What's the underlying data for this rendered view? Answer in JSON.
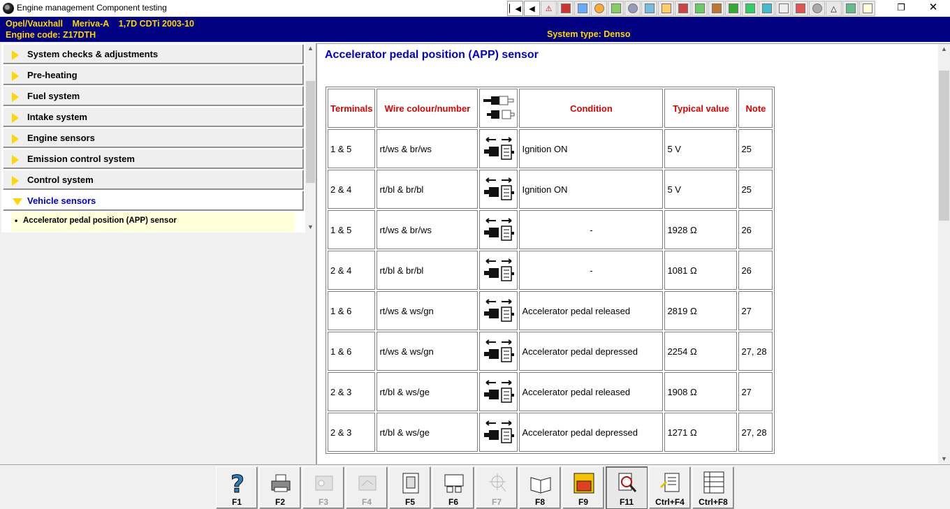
{
  "window": {
    "title": "Engine management Component testing"
  },
  "vehicle": {
    "make": "Opel/Vauxhall",
    "model": "Meriva-A",
    "engine": "1,7D CDTi 2003-10",
    "engine_code": "Engine code: Z17DTH",
    "system_type": "System type: Denso"
  },
  "nav": {
    "items": [
      {
        "label": "System checks & adjustments"
      },
      {
        "label": "Pre-heating"
      },
      {
        "label": "Fuel system"
      },
      {
        "label": "Intake system"
      },
      {
        "label": "Engine sensors"
      },
      {
        "label": "Emission control system"
      },
      {
        "label": "Control system"
      },
      {
        "label": "Vehicle sensors"
      }
    ],
    "subitem": "Accelerator pedal position (APP) sensor"
  },
  "content": {
    "title": "Accelerator pedal position (APP) sensor",
    "headers": {
      "terminals": "Terminals",
      "wire": "Wire colour/number",
      "condition": "Condition",
      "value": "Typical value",
      "note": "Note"
    },
    "rows": [
      {
        "terminals": "1 & 5",
        "wire": "rt/ws & br/ws",
        "condition": "Ignition ON",
        "value": "5 V",
        "note": "25"
      },
      {
        "terminals": "2 & 4",
        "wire": "rt/bl & br/bl",
        "condition": "Ignition ON",
        "value": "5 V",
        "note": "25"
      },
      {
        "terminals": "1 & 5",
        "wire": "rt/ws & br/ws",
        "condition": "-",
        "value": "1928 Ω",
        "note": "26"
      },
      {
        "terminals": "2 & 4",
        "wire": "rt/bl & br/bl",
        "condition": "-",
        "value": "1081 Ω",
        "note": "26"
      },
      {
        "terminals": "1 & 6",
        "wire": "rt/ws & ws/gn",
        "condition": "Accelerator pedal released",
        "value": "2819 Ω",
        "note": "27"
      },
      {
        "terminals": "1 & 6",
        "wire": "rt/ws & ws/gn",
        "condition": "Accelerator pedal depressed",
        "value": "2254 Ω",
        "note": "27, 28"
      },
      {
        "terminals": "2 & 3",
        "wire": "rt/bl & ws/ge",
        "condition": "Accelerator pedal released",
        "value": "1908 Ω",
        "note": "27"
      },
      {
        "terminals": "2 & 3",
        "wire": "rt/bl & ws/ge",
        "condition": "Accelerator pedal depressed",
        "value": "1271 Ω",
        "note": "27, 28"
      }
    ]
  },
  "function_keys": [
    {
      "label": "F1",
      "icon": "help-icon"
    },
    {
      "label": "F2",
      "icon": "printer-icon"
    },
    {
      "label": "F3",
      "icon": "component-location-icon",
      "disabled": true
    },
    {
      "label": "F4",
      "icon": "wiring-icon",
      "disabled": true
    },
    {
      "label": "F5",
      "icon": "fuse-icon"
    },
    {
      "label": "F6",
      "icon": "ecu-icon"
    },
    {
      "label": "F7",
      "icon": "adjustment-icon",
      "disabled": true
    },
    {
      "label": "F8",
      "icon": "book-icon"
    },
    {
      "label": "F9",
      "icon": "fault-code-icon"
    },
    {
      "label": "F11",
      "icon": "search-info-icon",
      "pressed": true
    },
    {
      "label": "Ctrl+F4",
      "icon": "notes-icon"
    },
    {
      "label": "Ctrl+F8",
      "icon": "list-icon"
    }
  ],
  "colors": {
    "info_bar_bg": "#000080",
    "info_bar_text": "#ffd700",
    "title": "#0000cc",
    "table_header": "#e00000"
  }
}
